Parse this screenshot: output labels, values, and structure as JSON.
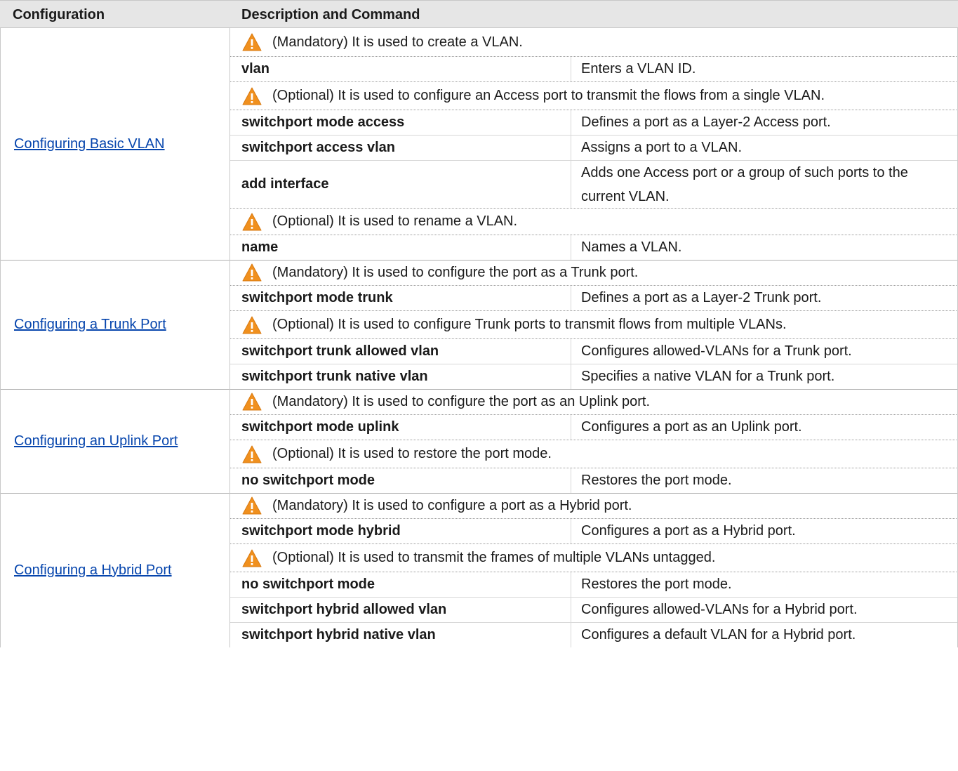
{
  "header": {
    "col1": "Configuration",
    "col2": "Description and Command"
  },
  "groups": [
    {
      "config_link": "Configuring Basic VLAN",
      "rows": [
        {
          "type": "note",
          "text": "(Mandatory) It is used to create a VLAN."
        },
        {
          "type": "cmd",
          "cmd": "vlan",
          "desc": "Enters a VLAN ID."
        },
        {
          "type": "note",
          "text": "(Optional) It is used to configure an Access port to transmit the flows from a single VLAN."
        },
        {
          "type": "cmd",
          "cmd": "switchport mode access",
          "desc": "Defines a port as a Layer-2 Access port."
        },
        {
          "type": "cmd",
          "cmd": "switchport access vlan",
          "desc": "Assigns a port to a VLAN."
        },
        {
          "type": "cmd",
          "cmd": "add interface",
          "desc": "Adds one Access port or a group of such ports to the current VLAN."
        },
        {
          "type": "note",
          "text": "(Optional) It is used to rename a VLAN."
        },
        {
          "type": "cmd",
          "cmd": "name",
          "desc": "Names a VLAN."
        }
      ]
    },
    {
      "config_link": "Configuring a Trunk Port",
      "rows": [
        {
          "type": "note",
          "text": "(Mandatory) It is used to configure the port as a Trunk port."
        },
        {
          "type": "cmd",
          "cmd": "switchport mode trunk",
          "desc": "Defines a port as a Layer-2 Trunk port."
        },
        {
          "type": "note",
          "text": "(Optional) It is used to configure Trunk ports to transmit flows from multiple VLANs."
        },
        {
          "type": "cmd",
          "cmd": "switchport trunk allowed vlan",
          "desc": "Configures allowed-VLANs for a Trunk port."
        },
        {
          "type": "cmd",
          "cmd": "switchport trunk native vlan",
          "desc": "Specifies a native VLAN for a Trunk port."
        }
      ]
    },
    {
      "config_link": "Configuring an Uplink Port",
      "rows": [
        {
          "type": "note",
          "text": "(Mandatory) It is used to configure the port as an Uplink port."
        },
        {
          "type": "cmd",
          "cmd": "switchport mode uplink",
          "desc": "Configures a port as an Uplink port."
        },
        {
          "type": "note",
          "text": "(Optional) It is used to restore the port mode."
        },
        {
          "type": "cmd",
          "cmd": "no switchport mode",
          "desc": "Restores the port mode."
        }
      ]
    },
    {
      "config_link": "Configuring a Hybrid Port",
      "rows": [
        {
          "type": "note",
          "text": "(Mandatory) It is used to configure a port as a Hybrid port."
        },
        {
          "type": "cmd",
          "cmd": "switchport mode hybrid",
          "desc": "Configures a port as a Hybrid port."
        },
        {
          "type": "note",
          "text": "(Optional) It is used to transmit the frames of multiple VLANs untagged."
        },
        {
          "type": "cmd",
          "cmd": "no switchport mode",
          "desc": "Restores the port mode."
        },
        {
          "type": "cmd",
          "cmd": "switchport hybrid allowed vlan",
          "desc": "Configures allowed-VLANs for a Hybrid port."
        },
        {
          "type": "cmd",
          "cmd": "switchport hybrid native vlan",
          "desc": "Configures a default VLAN for a Hybrid port."
        }
      ]
    }
  ],
  "icons": {
    "note": "warning-triangle-icon",
    "note_color": "#f0901e"
  }
}
